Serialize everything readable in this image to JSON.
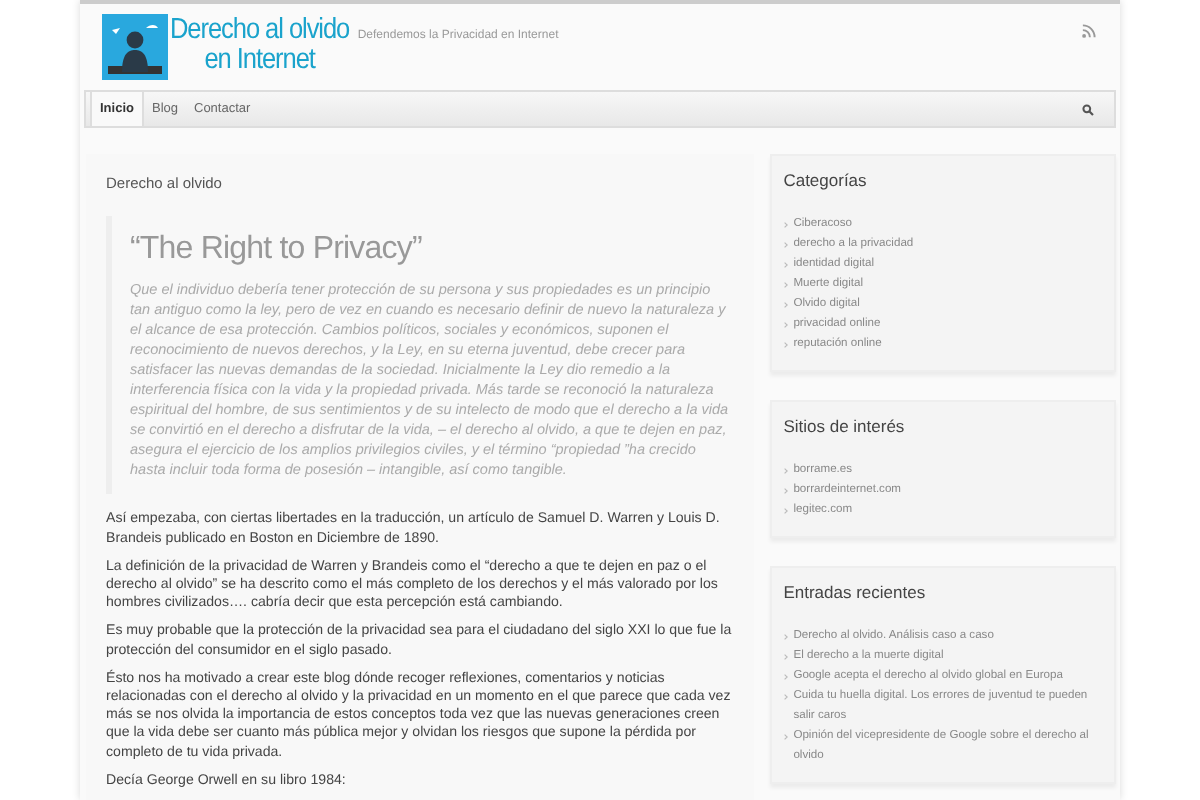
{
  "header": {
    "logo_lines": [
      "Derecho al olvido",
      "en Internet"
    ],
    "tagline": "Defendemos la Privacidad en Internet"
  },
  "nav": [
    {
      "label": "Inicio",
      "selected": true
    },
    {
      "label": "Blog",
      "selected": false
    },
    {
      "label": "Contactar",
      "selected": false
    }
  ],
  "article": {
    "title": "Derecho al olvido",
    "quote_title": "“The Right to Privacy”",
    "quote": "Que el individuo debería tener protección de su persona y sus propiedades es un principio tan antiguo como la ley, pero de vez en cuando es necesario definir de nuevo la naturaleza y el alcance de esa protección. Cambios políticos, sociales y económicos, suponen el reconocimiento de nuevos derechos, y la Ley, en su eterna juventud, debe crecer para satisfacer las nuevas demandas de la sociedad. Inicialmente la Ley dio remedio a la interferencia física con la vida y la propiedad privada. Más tarde se reconoció la naturaleza espiritual del hombre, de sus sentimientos y de su intelecto de modo que el derecho a la vida se convirtió en el derecho a disfrutar de la vida, – el derecho al olvido, a que te dejen en paz, asegura el ejercicio de los amplios privilegios civiles, y el término “propiedad ”ha crecido hasta incluir toda forma de posesión – intangible, así como tangible.",
    "paragraphs": [
      "Así empezaba, con ciertas libertades en la traducción, un artículo de Samuel D. Warren y Louis D. Brandeis publicado en Boston en Diciembre de 1890.",
      "La definición de la privacidad de Warren y Brandeis como el “derecho a que te dejen en paz o el derecho al olvido” se ha descrito como el más completo de los derechos y el más valorado por los hombres civilizados…. cabría decir que esta percepción está cambiando.",
      "Es muy probable que la protección de la privacidad sea para el ciudadano del siglo XXI lo que fue la protección del consumidor en el siglo pasado.",
      "Ésto nos ha motivado a crear este blog dónde recoger reflexiones, comentarios y noticias relacionadas con el derecho al olvido y la privacidad en un momento en el que parece que cada vez más se nos olvida la importancia de estos conceptos toda vez que las nuevas generaciones creen que la vida debe ser cuanto más pública mejor y olvidan los riesgos que supone la pérdida por completo de tu vida privada.",
      "Decía George Orwell en su libro 1984:"
    ]
  },
  "sidebar": [
    {
      "title": "Categorías",
      "items": [
        "Ciberacoso",
        "derecho a la privacidad",
        "identidad digital",
        "Muerte digital",
        "Olvido digital",
        "privacidad online",
        "reputación online"
      ]
    },
    {
      "title": "Sitios de interés",
      "items": [
        "borrame.es",
        "borrardeinternet.com",
        "legitec.com"
      ]
    },
    {
      "title": "Entradas recientes",
      "items": [
        "Derecho al olvido. Análisis caso a caso",
        "El derecho a la muerte digital",
        "Google acepta el derecho al olvido global en Europa",
        "Cuida tu huella digital. Los errores de juventud te pueden salir caros",
        "Opinión del vicepresidente de Google sobre el derecho al olvido"
      ]
    }
  ]
}
